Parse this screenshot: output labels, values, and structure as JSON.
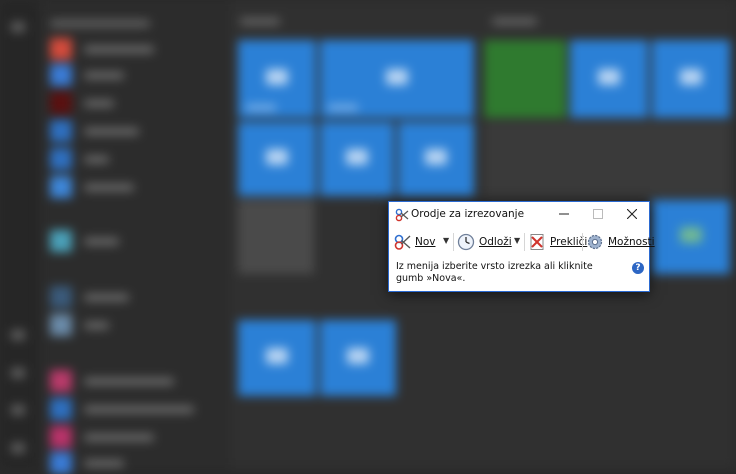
{
  "snipping_tool": {
    "title": "Orodje za izrezovanje",
    "toolbar": {
      "new_label": "Nov",
      "delay_label": "Odloži",
      "cancel_label": "Prekliči",
      "options_label": "Možnosti"
    },
    "status_message": "Iz menija izberite vrsto izrezka ali kliknite gumb »Nova«.",
    "help_glyph": "?",
    "window_buttons": {
      "minimize": "—",
      "maximize": "☐",
      "close": "✕"
    }
  },
  "colors": {
    "tile_blue": "#2b80d6",
    "window_border": "#2b6ad1",
    "help_blue": "#2d66c4",
    "desktop_dark": "#2a2a2a"
  },
  "icons": {
    "app": "scissors-icon",
    "new": "snip-icon",
    "delay": "clock-icon",
    "cancel": "cancel-icon",
    "options": "gear-icon",
    "help": "help-icon"
  }
}
